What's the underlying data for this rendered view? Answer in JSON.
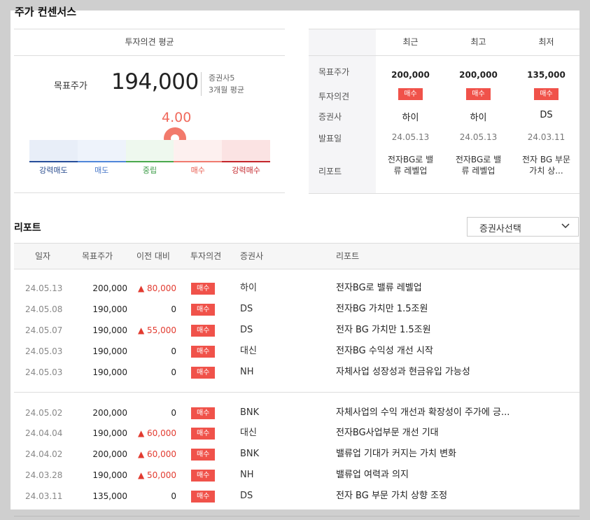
{
  "section_title": "주가 컨센서스",
  "left_card": {
    "header": "투자의견 평균",
    "target_price_label": "목표주가",
    "target_price_value": "194,000",
    "brokers_count": "증권사5",
    "avg_period": "3개월 평균",
    "opinion_score": "4.00",
    "opinion_score_numeric": 4.0,
    "gauge_labels": [
      "강력매도",
      "매도",
      "중립",
      "매수",
      "강력매수"
    ],
    "gauge_label_colors": [
      "#2a4d8f",
      "#4a79c9",
      "#3a9b45",
      "#e8584b",
      "#c4262b"
    ],
    "gauge_bg_colors": [
      "#e8eef8",
      "#eef3fb",
      "#eef8ee",
      "#fdf0ef",
      "#fbe3e3"
    ],
    "gauge_line_colors": [
      "#274e9a",
      "#4f86d9",
      "#4aa84d",
      "#f07b6f",
      "#c4262b"
    ]
  },
  "right_card": {
    "columns": [
      "최근",
      "최고",
      "최저"
    ],
    "row_labels": [
      "목표주가",
      "투자의견",
      "증권사",
      "발표일",
      "리포트"
    ],
    "target_prices": [
      "200,000",
      "200,000",
      "135,000"
    ],
    "opinions": [
      "매수",
      "매수",
      "매수"
    ],
    "brokers": [
      "하이",
      "하이",
      "DS"
    ],
    "dates": [
      "24.05.13",
      "24.05.13",
      "24.03.11"
    ],
    "reports": [
      {
        "line1": "전자BG로 밸",
        "line2": "류 레벨업"
      },
      {
        "line1": "전자BG로 밸",
        "line2": "류 레벨업"
      },
      {
        "line1": "전자 BG 부문",
        "line2": "가치 상..."
      }
    ]
  },
  "reports_section": {
    "title": "리포트",
    "select_label": "증권사선택",
    "headers": [
      "일자",
      "목표주가",
      "이전 대비",
      "투자의견",
      "증권사",
      "리포트"
    ],
    "rows": [
      {
        "date": "24.05.13",
        "price": "200,000",
        "diff": "▲ 80,000",
        "up": true,
        "opinion": "매수",
        "broker": "하이",
        "report": "전자BG로 밸류 레벨업"
      },
      {
        "date": "24.05.08",
        "price": "190,000",
        "diff": "0",
        "up": false,
        "opinion": "매수",
        "broker": "DS",
        "report": "전자BG 가치만 1.5조원"
      },
      {
        "date": "24.05.07",
        "price": "190,000",
        "diff": "▲ 55,000",
        "up": true,
        "opinion": "매수",
        "broker": "DS",
        "report": "전자 BG 가치만 1.5조원"
      },
      {
        "date": "24.05.03",
        "price": "190,000",
        "diff": "0",
        "up": false,
        "opinion": "매수",
        "broker": "대신",
        "report": "전자BG 수익성 개선 시작"
      },
      {
        "date": "24.05.03",
        "price": "190,000",
        "diff": "0",
        "up": false,
        "opinion": "매수",
        "broker": "NH",
        "report": "자체사업 성장성과 현금유입 가능성"
      },
      {
        "date": "24.05.02",
        "price": "200,000",
        "diff": "0",
        "up": false,
        "opinion": "매수",
        "broker": "BNK",
        "report": "자체사업의 수익 개선과 확장성이 주가에 긍..."
      },
      {
        "date": "24.04.04",
        "price": "190,000",
        "diff": "▲ 60,000",
        "up": true,
        "opinion": "매수",
        "broker": "대신",
        "report": "전자BG사업부문 개선 기대"
      },
      {
        "date": "24.04.02",
        "price": "200,000",
        "diff": "▲ 60,000",
        "up": true,
        "opinion": "매수",
        "broker": "BNK",
        "report": "밸류업 기대가 커지는 가치 변화"
      },
      {
        "date": "24.03.28",
        "price": "190,000",
        "diff": "▲ 50,000",
        "up": true,
        "opinion": "매수",
        "broker": "NH",
        "report": "밸류업 여력과 의지"
      },
      {
        "date": "24.03.11",
        "price": "135,000",
        "diff": "0",
        "up": false,
        "opinion": "매수",
        "broker": "DS",
        "report": "전자 BG 부문 가치 상향 조정"
      }
    ]
  },
  "colors": {
    "buy_badge": "#f0524a",
    "up": "#e23b30",
    "pin": "#f27a6c"
  }
}
